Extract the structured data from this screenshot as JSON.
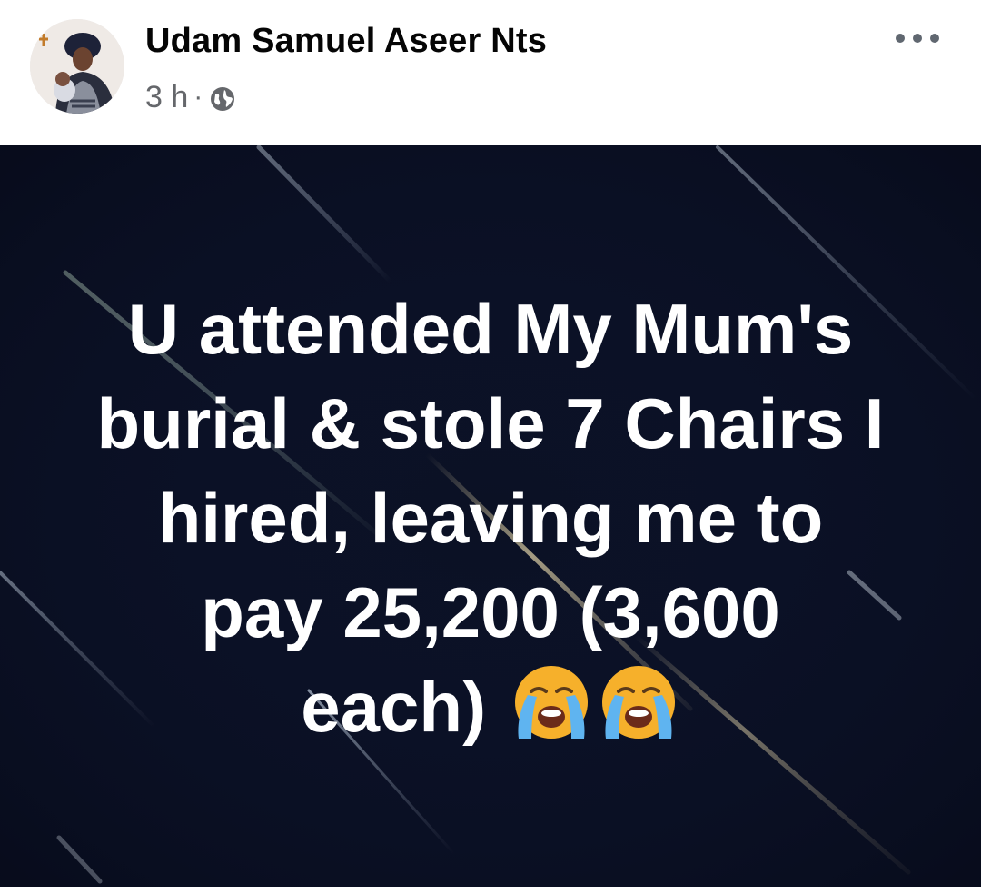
{
  "post": {
    "author_name": "Udam Samuel Aseer Nts",
    "time_ago": "3 h",
    "separator": "·",
    "audience_icon": "globe-icon",
    "more_icon": "ellipsis-icon"
  },
  "status": {
    "lines": [
      "U attended My Mum's",
      "burial & stole 7 Chairs I",
      "hired, leaving me to",
      "pay 25,200 (3,600",
      "each)"
    ],
    "emoji": "loudly-crying-face-icon",
    "emoji_count": 2
  },
  "colors": {
    "card_background": "#0b1124",
    "text": "#ffffff",
    "meta_text": "#65676b"
  }
}
